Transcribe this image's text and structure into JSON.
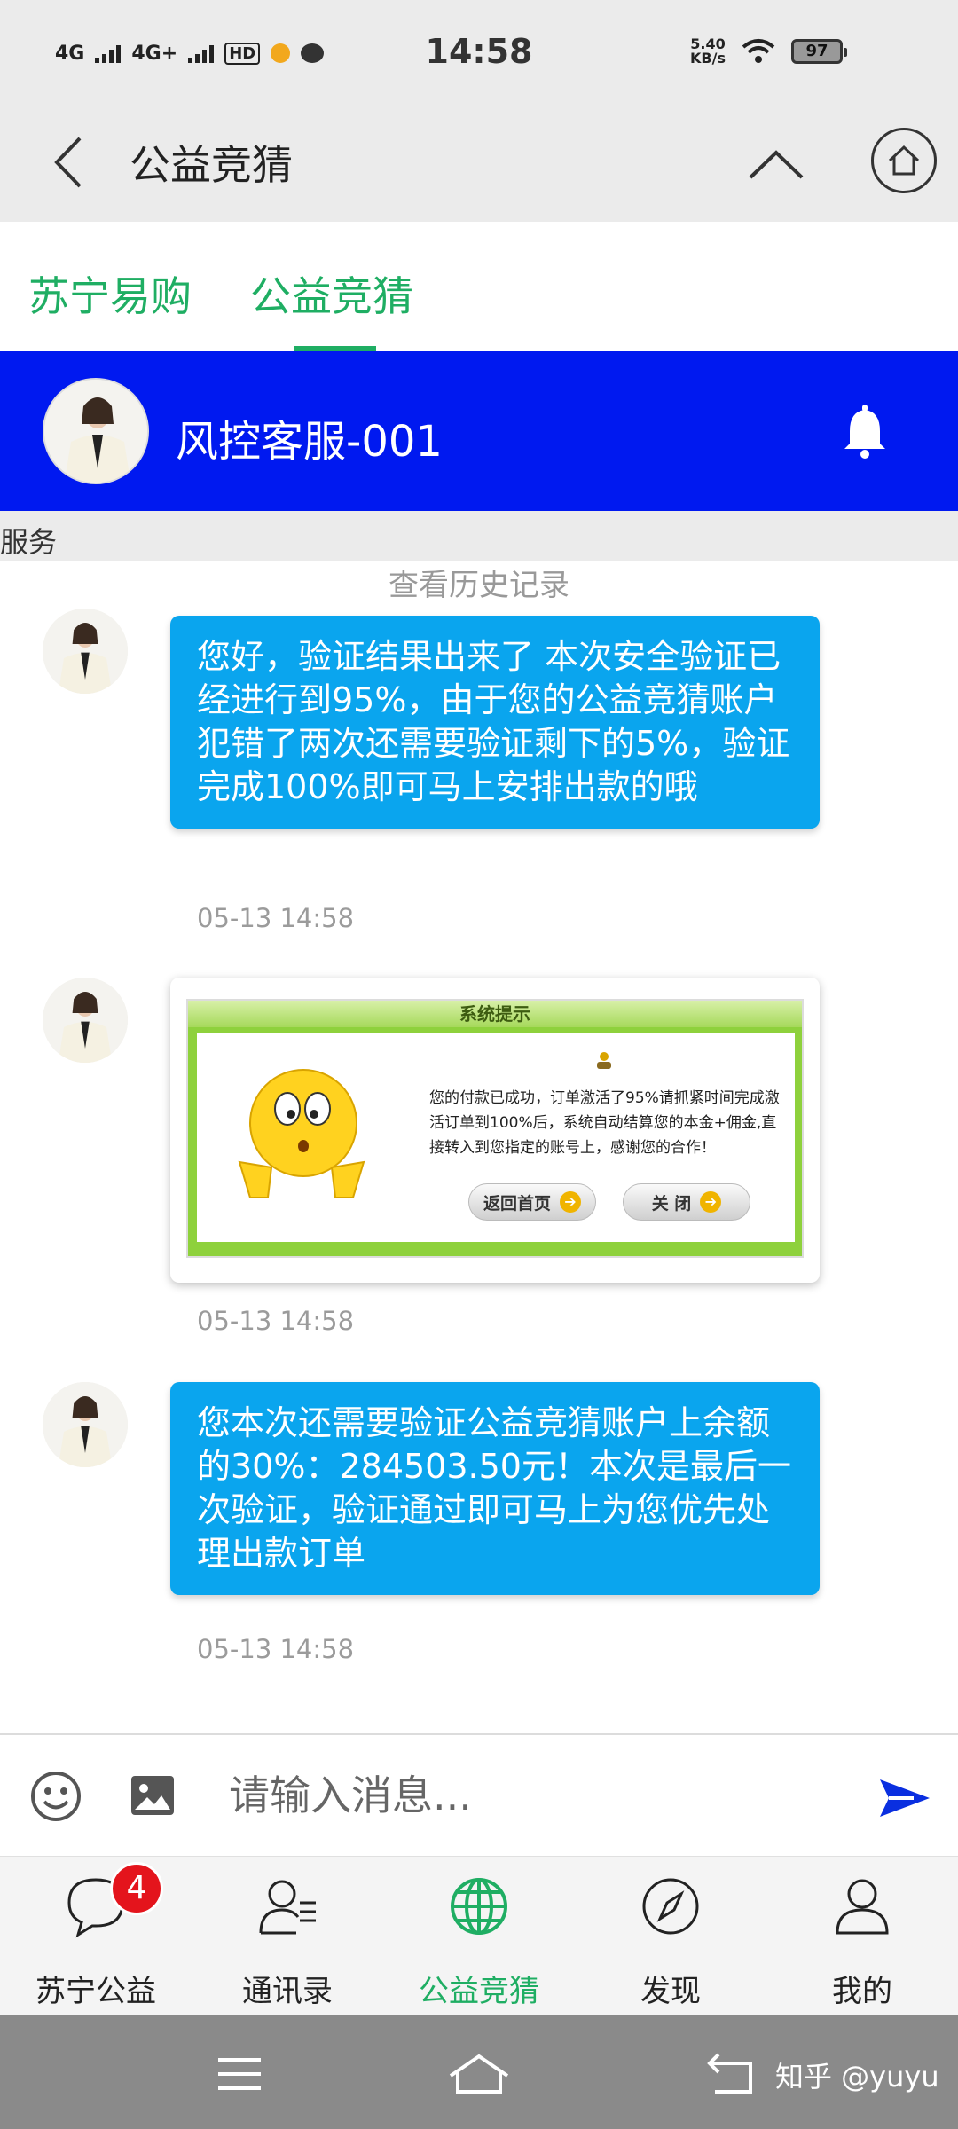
{
  "status_bar": {
    "network_1": "4G",
    "network_2": "4G+",
    "hd": "HD",
    "time": "14:58",
    "speed_value": "5.40",
    "speed_unit": "KB/s",
    "battery": "97"
  },
  "title_bar": {
    "title": "公益竞猜"
  },
  "tabs": [
    {
      "label": "苏宁易购"
    },
    {
      "label": "公益竞猜"
    }
  ],
  "chat_header": {
    "name": "风控客服-001"
  },
  "service_bar": {
    "text": "服务"
  },
  "history_link": "查看历史记录",
  "messages": [
    {
      "text": "您好，验证结果出来了 本次安全验证已经进行到95%，由于您的公益竞猜账户犯错了两次还需要验证剩下的5%，验证完成100%即可马上安排出款的哦",
      "time": "05-13 14:58"
    },
    {
      "image": {
        "title": "系统提示",
        "text": "您的付款已成功，订单激活了95%请抓紧时间完成激活订单到100%后，系统自动结算您的本金+佣金,直接转入到您指定的账号上，感谢您的合作！",
        "button_home": "返回首页",
        "button_close": "关 闭"
      },
      "time": "05-13 14:58"
    },
    {
      "text": "您本次还需要验证公益竞猜账户上余额的30%：284503.50元！本次是最后一次验证，验证通过即可马上为您优先处理出款订单",
      "time": "05-13 14:58"
    }
  ],
  "input_bar": {
    "placeholder": "请输入消息..."
  },
  "bottom_nav": {
    "items": [
      {
        "label": "苏宁公益",
        "badge": "4",
        "icon": "chat-bubble-icon"
      },
      {
        "label": "通讯录",
        "icon": "contacts-icon"
      },
      {
        "label": "公益竞猜",
        "icon": "globe-icon",
        "active": true
      },
      {
        "label": "发现",
        "icon": "compass-icon"
      },
      {
        "label": "我的",
        "icon": "person-icon"
      }
    ]
  },
  "watermark": "知乎 @yuyu",
  "colors": {
    "accent_green": "#1fae63",
    "header_blue": "#0019f0",
    "bubble_blue": "#0aa5ee",
    "badge_red": "#e4141c"
  }
}
